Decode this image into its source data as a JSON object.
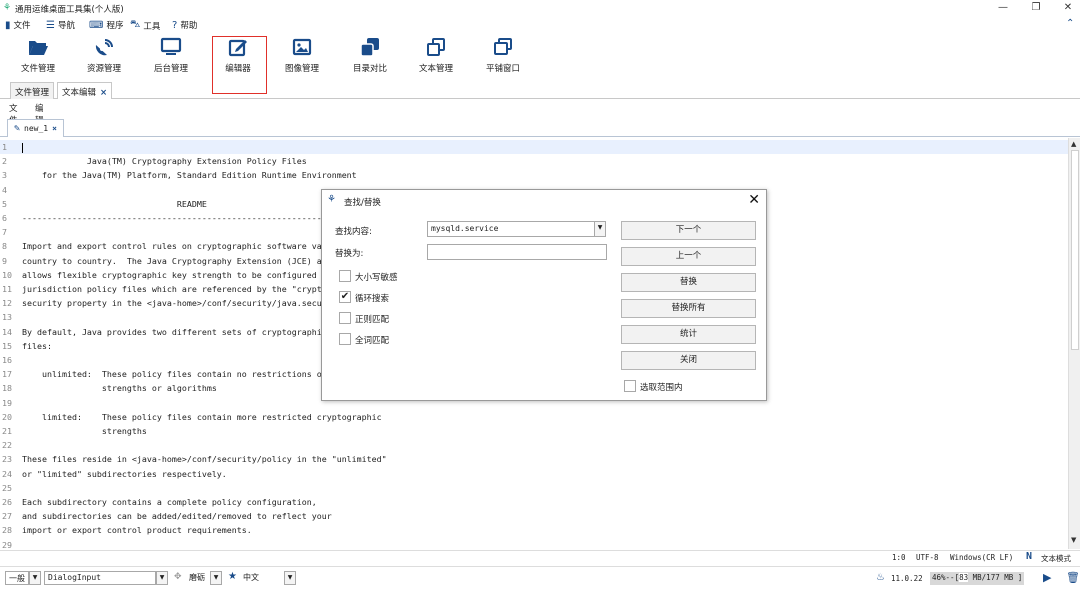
{
  "window": {
    "title": "通用运维桌面工具集(个人版)",
    "min": "—",
    "max": "❐",
    "close": "✕"
  },
  "menubar": {
    "file": "文件",
    "nav": "导航",
    "program": "程序",
    "tools": "工具",
    "help": "帮助"
  },
  "toolbar": [
    {
      "label": "文件管理",
      "icon": "folder-open-icon"
    },
    {
      "label": "资源管理",
      "icon": "satellite-dish-icon"
    },
    {
      "label": "后台管理",
      "icon": "monitor-icon"
    },
    {
      "label": "编辑器",
      "icon": "edit-icon"
    },
    {
      "label": "图像管理",
      "icon": "image-icon"
    },
    {
      "label": "目录对比",
      "icon": "compare-icon"
    },
    {
      "label": "文本管理",
      "icon": "copy-icon"
    },
    {
      "label": "平铺窗口",
      "icon": "windows-icon"
    }
  ],
  "outer_tabs": {
    "file_mgmt": "文件管理",
    "text_edit": "文本编辑",
    "close": "×"
  },
  "inner_menu": {
    "file": "文件",
    "edit": "编辑"
  },
  "doc_tab": {
    "name": "new_1",
    "close": "×"
  },
  "editor_lines": [
    {
      "n": "1",
      "t": ""
    },
    {
      "n": "2",
      "t": "             Java(TM) Cryptography Extension Policy Files"
    },
    {
      "n": "3",
      "t": "    for the Java(TM) Platform, Standard Edition Runtime Environment"
    },
    {
      "n": "4",
      "t": ""
    },
    {
      "n": "5",
      "t": "                               README"
    },
    {
      "n": "6",
      "t": "------------------------------------------------------------------------"
    },
    {
      "n": "7",
      "t": ""
    },
    {
      "n": "8",
      "t": "Import and export control rules on cryptographic software vary from"
    },
    {
      "n": "9",
      "t": "country to country.  The Java Cryptography Extension (JCE) architecture"
    },
    {
      "n": "10",
      "t": "allows flexible cryptographic key strength to be configured via the"
    },
    {
      "n": "11",
      "t": "jurisdiction policy files which are referenced by the \"crypto.policy\""
    },
    {
      "n": "12",
      "t": "security property in the <java-home>/conf/security/java.security file."
    },
    {
      "n": "13",
      "t": ""
    },
    {
      "n": "14",
      "t": "By default, Java provides two different sets of cryptographic policy"
    },
    {
      "n": "15",
      "t": "files:"
    },
    {
      "n": "16",
      "t": ""
    },
    {
      "n": "17",
      "t": "    unlimited:  These policy files contain no restrictions on cryptographic"
    },
    {
      "n": "18",
      "t": "                strengths or algorithms"
    },
    {
      "n": "19",
      "t": ""
    },
    {
      "n": "20",
      "t": "    limited:    These policy files contain more restricted cryptographic"
    },
    {
      "n": "21",
      "t": "                strengths"
    },
    {
      "n": "22",
      "t": ""
    },
    {
      "n": "23",
      "t": "These files reside in <java-home>/conf/security/policy in the \"unlimited\""
    },
    {
      "n": "24",
      "t": "or \"limited\" subdirectories respectively."
    },
    {
      "n": "25",
      "t": ""
    },
    {
      "n": "26",
      "t": "Each subdirectory contains a complete policy configuration,"
    },
    {
      "n": "27",
      "t": "and subdirectories can be added/edited/removed to reflect your"
    },
    {
      "n": "28",
      "t": "import or export control product requirements."
    },
    {
      "n": "29",
      "t": ""
    }
  ],
  "dialog": {
    "title": "查找/替换",
    "close": "✕",
    "find_label": "查找内容:",
    "find_value": "mysqld.service",
    "replace_label": "替换为:",
    "replace_value": "",
    "opt_case": "大小写敏感",
    "opt_loop": "循环搜索",
    "opt_regex": "正则匹配",
    "opt_whole": "全词匹配",
    "opt_inselection": "选取范围内",
    "btn_next": "下一个",
    "btn_prev": "上一个",
    "btn_replace": "替换",
    "btn_replace_all": "替换所有",
    "btn_count": "统计",
    "btn_close": "关闭"
  },
  "status": {
    "pos": "1:0",
    "enc": "UTF-8",
    "eol": "Windows(CR LF)",
    "mode_icon": "N",
    "mode": "文本模式"
  },
  "bottom": {
    "style": "一般",
    "font": "DialogInput",
    "theme": "磨砺",
    "lang": "中文",
    "version": "11.0.22",
    "mem_pct": "46%--[",
    "mem_used": "83",
    "mem_tail": "MB/177 MB ]"
  },
  "colors": {
    "accent": "#1a4c8a",
    "highlight": "#e0302a",
    "current_line": "#e8f0fe"
  }
}
